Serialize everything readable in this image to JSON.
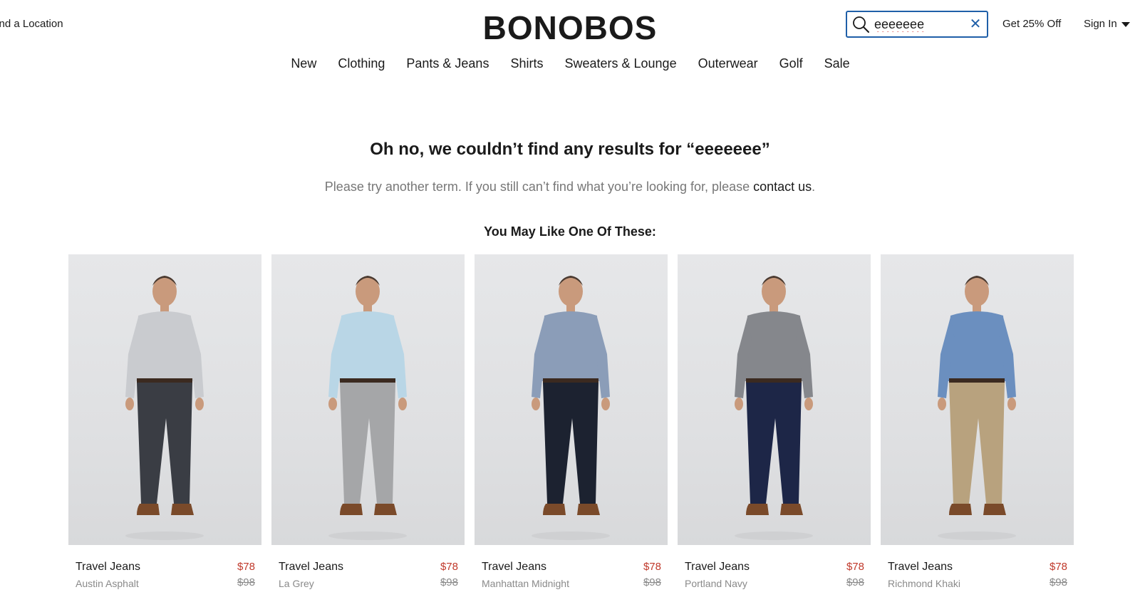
{
  "header": {
    "find_location": "Find a Location",
    "logo": "BONOBOS",
    "search": {
      "value": "eeeeeee",
      "placeholder": ""
    },
    "promo": "Get 25% Off",
    "sign_in": "Sign In"
  },
  "nav": {
    "items": [
      {
        "label": "New"
      },
      {
        "label": "Clothing"
      },
      {
        "label": "Pants & Jeans"
      },
      {
        "label": "Shirts"
      },
      {
        "label": "Sweaters & Lounge"
      },
      {
        "label": "Outerwear"
      },
      {
        "label": "Golf"
      },
      {
        "label": "Sale"
      }
    ]
  },
  "empty_state": {
    "headline": "Oh no, we couldn’t find any results for “eeeeeee”",
    "message": "Please try another term. If you still can’t find what you’re looking for, please",
    "contact_link": "contact us",
    "period": ".",
    "reco_title": "You May Like One Of These:"
  },
  "products": [
    {
      "name": "Travel Jeans",
      "color": "Austin Asphalt",
      "sale_price": "$78",
      "original_price": "$98",
      "shirt": "#c9cbcf",
      "pants": "#3a3d44"
    },
    {
      "name": "Travel Jeans",
      "color": "La Grey",
      "sale_price": "$78",
      "original_price": "$98",
      "shirt": "#b9d6e6",
      "pants": "#a5a6a8"
    },
    {
      "name": "Travel Jeans",
      "color": "Manhattan Midnight",
      "sale_price": "$78",
      "original_price": "$98",
      "shirt": "#8b9db8",
      "pants": "#1c2230"
    },
    {
      "name": "Travel Jeans",
      "color": "Portland Navy",
      "sale_price": "$78",
      "original_price": "$98",
      "shirt": "#85878c",
      "pants": "#1d2647"
    },
    {
      "name": "Travel Jeans",
      "color": "Richmond Khaki",
      "sale_price": "$78",
      "original_price": "$98",
      "shirt": "#6b8fbf",
      "pants": "#b8a27e"
    }
  ]
}
